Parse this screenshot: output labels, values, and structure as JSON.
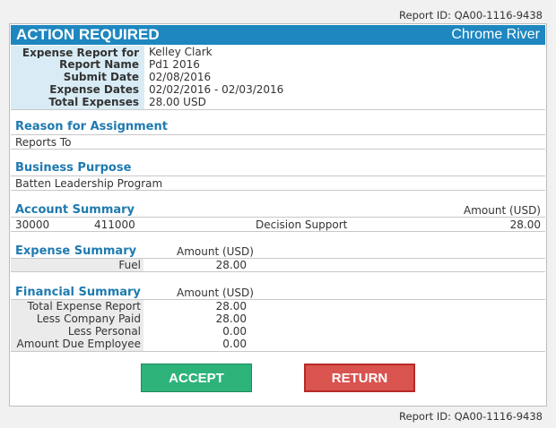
{
  "report_id_text": "Report ID: QA00-1116-9438",
  "header": {
    "title": "ACTION REQUIRED",
    "brand": "Chrome River"
  },
  "summary": [
    {
      "label": "Expense Report for",
      "value": "Kelley Clark"
    },
    {
      "label": "Report Name",
      "value": "Pd1 2016"
    },
    {
      "label": "Submit Date",
      "value": "02/08/2016"
    },
    {
      "label": "Expense Dates",
      "value": "02/02/2016 - 02/03/2016"
    },
    {
      "label": "Total Expenses",
      "value": "28.00 USD"
    }
  ],
  "reason": {
    "title": "Reason for Assignment",
    "value": "Reports To"
  },
  "business": {
    "title": "Business Purpose",
    "value": "Batten Leadership Program"
  },
  "account": {
    "title": "Account Summary",
    "amount_header": "Amount (USD)",
    "row": {
      "code1": "30000",
      "code2": "411000",
      "desc": "Decision Support",
      "amount": "28.00"
    }
  },
  "expense": {
    "title": "Expense Summary",
    "amount_header": "Amount (USD)",
    "rows": [
      {
        "label": "Fuel",
        "amount": "28.00"
      }
    ]
  },
  "financial": {
    "title": "Financial Summary",
    "amount_header": "Amount (USD)",
    "rows": [
      {
        "label": "Total Expense Report",
        "amount": "28.00"
      },
      {
        "label": "Less Company Paid",
        "amount": "28.00"
      },
      {
        "label": "Less Personal",
        "amount": "0.00"
      },
      {
        "label": "Amount Due Employee",
        "amount": "0.00"
      }
    ]
  },
  "buttons": {
    "accept": "ACCEPT",
    "return": "RETURN"
  },
  "colors": {
    "header": "#1e87c0",
    "section_title": "#1e7ab0",
    "accept": "#2db37a",
    "return": "#d9534f"
  }
}
